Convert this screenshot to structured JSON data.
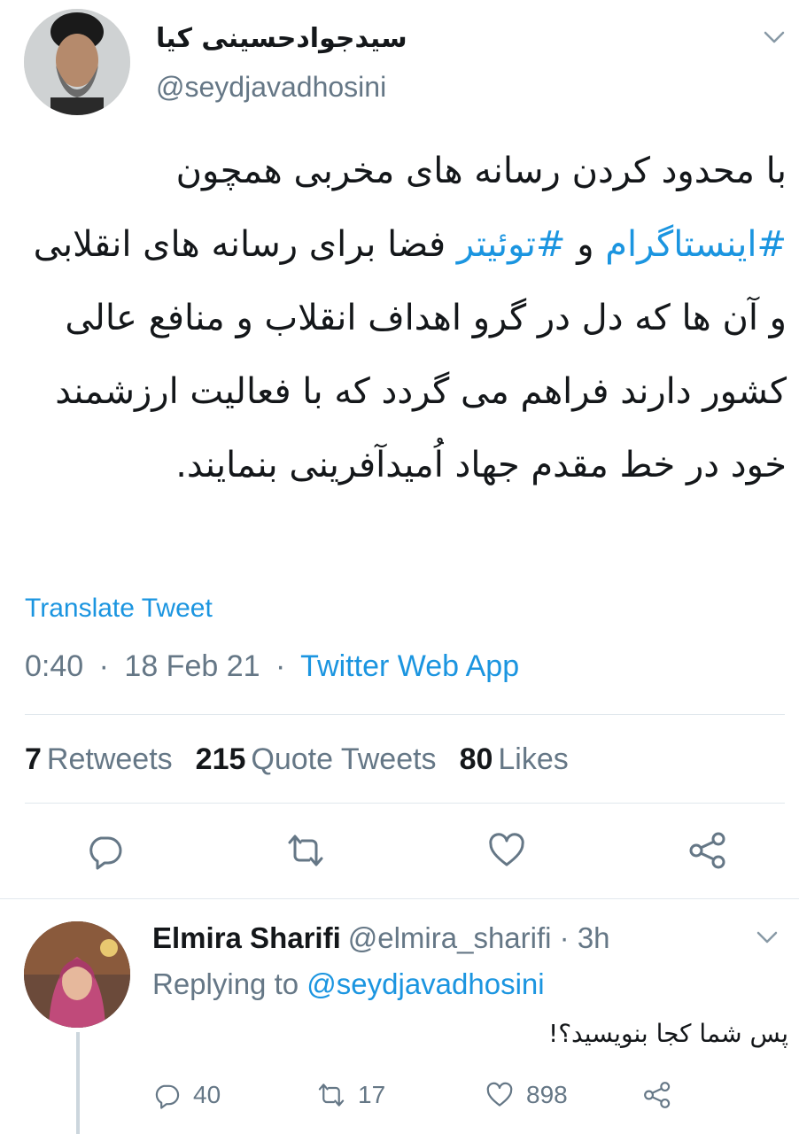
{
  "tweet": {
    "author_name": "سیدجوادحسینی کیا",
    "author_handle": "@seydjavadhosini",
    "body": {
      "line1": "با محدود کردن رسانه های مخربی همچون",
      "hashtag_instagram": "#اینستاگرام",
      "and": " و ",
      "hashtag_twitter": "#توئیتر",
      "rest": " فضا برای رسانه های انقلابی و آن ها که دل در گرو اهداف انقلاب و منافع عالی کشور دارند فراهم می گردد که با فعالیت ارزشمند خود در خط مقدم جهاد اُمیدآفرینی بنمایند."
    },
    "translate_label": "Translate Tweet",
    "time": "0:40",
    "date": "18 Feb 21",
    "separator": "·",
    "app": "Twitter Web App",
    "stats": {
      "retweets_count": "7",
      "retweets_label": "Retweets",
      "quotes_count": "215",
      "quotes_label": "Quote Tweets",
      "likes_count": "80",
      "likes_label": "Likes"
    },
    "icons": [
      "reply-icon",
      "retweet-icon",
      "like-icon",
      "share-icon"
    ]
  },
  "reply": {
    "name": "Elmira Sharifi",
    "handle": "@elmira_sharifi",
    "separator": "·",
    "time": "3h",
    "replying_label": "Replying to",
    "replying_to": "@seydjavadhosini",
    "text": "پس شما کجا بنویسید؟!",
    "reply_count": "40",
    "retweet_count": "17",
    "like_count": "898"
  },
  "colors": {
    "accent": "#1b95e0",
    "muted": "#657786",
    "text": "#14171a",
    "divider": "#e1e8ed"
  }
}
